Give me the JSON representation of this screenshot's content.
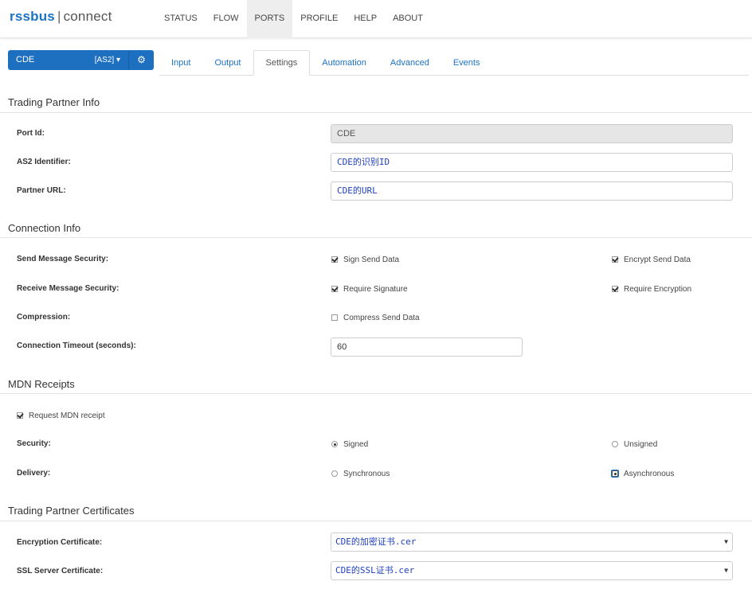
{
  "header": {
    "logo_brand": "rssbus",
    "logo_sep": "|",
    "logo_product": "connect",
    "nav": [
      "STATUS",
      "FLOW",
      "PORTS",
      "PROFILE",
      "HELP",
      "ABOUT"
    ],
    "active_nav": "PORTS"
  },
  "port": {
    "name": "CDE",
    "type": "[AS2]",
    "dropdown_icon": "caret-down-icon",
    "settings_icon": "gear-icon"
  },
  "tabs": [
    "Input",
    "Output",
    "Settings",
    "Automation",
    "Advanced",
    "Events"
  ],
  "active_tab": "Settings",
  "trading_partner_info": {
    "title": "Trading Partner Info",
    "port_id_label": "Port Id:",
    "port_id_value": "CDE",
    "as2_identifier_label": "AS2 Identifier:",
    "as2_identifier_value": "CDE的识别ID",
    "partner_url_label": "Partner URL:",
    "partner_url_value": "CDE的URL"
  },
  "connection_info": {
    "title": "Connection Info",
    "send_security_label": "Send Message Security:",
    "sign_send_data": "Sign Send Data",
    "encrypt_send_data": "Encrypt Send Data",
    "receive_security_label": "Receive Message Security:",
    "require_signature": "Require Signature",
    "require_encryption": "Require Encryption",
    "compression_label": "Compression:",
    "compress_send_data": "Compress Send Data",
    "timeout_label": "Connection Timeout (seconds):",
    "timeout_value": "60"
  },
  "mdn_receipts": {
    "title": "MDN Receipts",
    "request_mdn": "Request MDN receipt",
    "security_label": "Security:",
    "signed": "Signed",
    "unsigned": "Unsigned",
    "delivery_label": "Delivery:",
    "synchronous": "Synchronous",
    "asynchronous": "Asynchronous"
  },
  "certificates": {
    "title": "Trading Partner Certificates",
    "encryption_label": "Encryption Certificate:",
    "encryption_value": "CDE的加密证书.cer",
    "ssl_label": "SSL Server Certificate:",
    "ssl_value": "CDE的SSL证书.cer"
  },
  "colors": {
    "accent": "#1d6fbf",
    "link": "#1a73c4",
    "cjk_text": "#1f3fbf"
  }
}
